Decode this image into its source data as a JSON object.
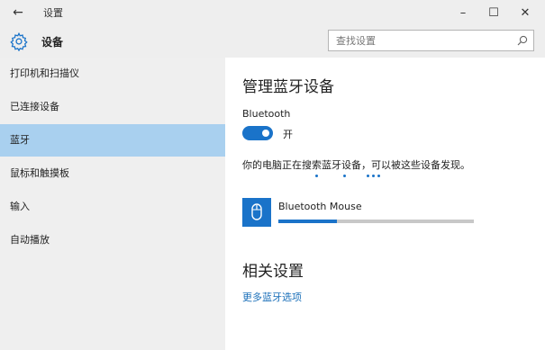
{
  "titlebar": {
    "back_glyph": "←",
    "title": "设置",
    "minimize_glyph": "–",
    "maximize_glyph": "☐",
    "close_glyph": "✕"
  },
  "header": {
    "page_title": "设备",
    "icon": "gear-icon",
    "search": {
      "placeholder": "查找设置",
      "value": "",
      "icon": "search-icon"
    }
  },
  "sidebar": {
    "items": [
      {
        "label": "打印机和扫描仪",
        "active": false
      },
      {
        "label": "已连接设备",
        "active": false
      },
      {
        "label": "蓝牙",
        "active": true
      },
      {
        "label": "鼠标和触摸板",
        "active": false
      },
      {
        "label": "输入",
        "active": false
      },
      {
        "label": "自动播放",
        "active": false
      }
    ]
  },
  "main": {
    "heading": "管理蓝牙设备",
    "bluetooth_label": "Bluetooth",
    "toggle_state": "开",
    "toggle_on": true,
    "discovery_text": "你的电脑正在搜索蓝牙设备，可以被这些设备发现。",
    "devices": [
      {
        "name": "Bluetooth Mouse",
        "icon": "mouse-icon",
        "progress": 0.3
      }
    ],
    "related_heading": "相关设置",
    "more_link": "更多蓝牙选项"
  },
  "colors": {
    "accent": "#1a73c9",
    "sidebar_bg": "#efefef",
    "active_item_bg": "#a9d0ef",
    "link": "#1a6fb9"
  }
}
